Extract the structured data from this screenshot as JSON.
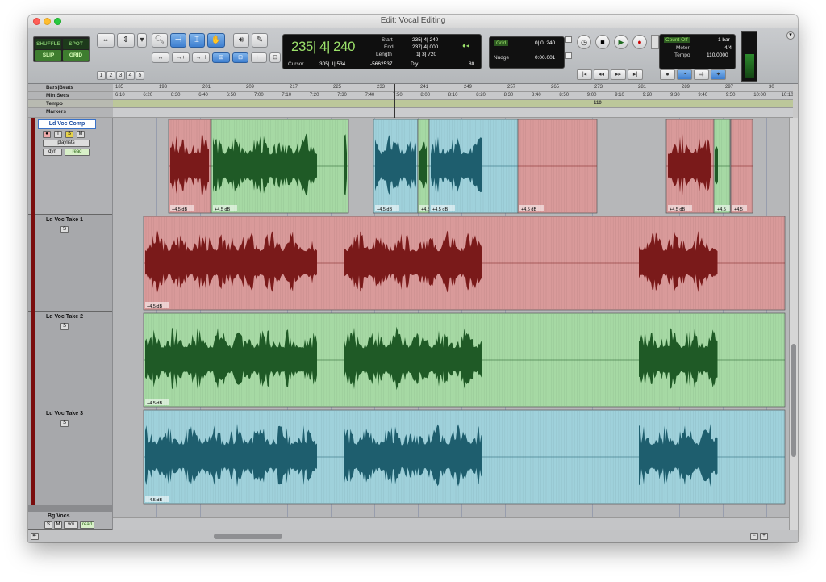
{
  "window": {
    "title": "Edit: Vocal Editing"
  },
  "modes": {
    "shuffle": "SHUFFLE",
    "spot": "SPOT",
    "slip": "SLIP",
    "grid": "GRID"
  },
  "zoom_presets": [
    "1",
    "2",
    "3",
    "4",
    "5"
  ],
  "counter": {
    "main": "235| 4| 240",
    "start_label": "Start",
    "start": "235| 4| 240",
    "end_label": "End",
    "end": "237| 4| 000",
    "length_label": "Length",
    "length": "1| 3| 720",
    "cursor_label": "Cursor",
    "cursor": "305| 1| 534",
    "sample": "-5662537",
    "dly": "Dly",
    "nudge_value": "80"
  },
  "grid": {
    "label": "Grid",
    "value": "0| 0| 240",
    "nudge_label": "Nudge",
    "nudge_value": "0:00.001"
  },
  "tempo_panel": {
    "count_off": "Count Off",
    "bars": "1 bar",
    "meter_label": "Meter",
    "meter": "4/4",
    "tempo_label": "Tempo",
    "tempo": "110.0000"
  },
  "rulers": {
    "bars_beats_label": "Bars|Beats",
    "min_secs_label": "Min:Secs",
    "tempo_label": "Tempo",
    "markers_label": "Markers",
    "bars": [
      "185",
      "193",
      "201",
      "209",
      "217",
      "225",
      "233",
      "241",
      "249",
      "257",
      "265",
      "273",
      "281",
      "289",
      "297",
      "30"
    ],
    "times": [
      "6:10",
      "6:20",
      "6:30",
      "6:40",
      "6:50",
      "7:00",
      "7:10",
      "7:20",
      "7:30",
      "7:40",
      "7:50",
      "8:00",
      "8:10",
      "8:20",
      "8:30",
      "8:40",
      "8:50",
      "9:00",
      "9:10",
      "9:20",
      "9:30",
      "9:40",
      "9:50",
      "10:00",
      "10:10"
    ],
    "tempo_value": "110"
  },
  "tracks": [
    {
      "name": "Ld Voc Comp",
      "playlists": "playlists",
      "automation": "dyn",
      "mode": "read"
    },
    {
      "name": "Ld Voc Take 1"
    },
    {
      "name": "Ld Voc Take 2"
    },
    {
      "name": "Ld Voc Take 3"
    },
    {
      "name": "Bg Vocs",
      "btn_m": "M",
      "btn_voi": "voi",
      "btn_read": "read"
    }
  ],
  "clip_gain": "+4.5 dB",
  "clip_gain_short": "+4.5",
  "colors": {
    "red_clip": "#d99a9a",
    "green_clip": "#a6d9a4",
    "blue_clip": "#9fd1db",
    "red_wave": "#7a1a1a",
    "green_wave": "#1f5a26",
    "blue_wave": "#1e5e6e",
    "counter_green": "#9be06a"
  }
}
